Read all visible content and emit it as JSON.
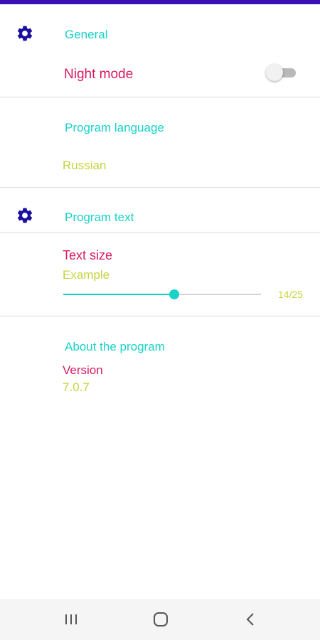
{
  "colors": {
    "status_bar": "#3b0fb5",
    "icon": "#1a0f9e",
    "heading": "#19d2c8",
    "primary_text": "#d81b60",
    "secondary_text": "#c6d43c",
    "slider_accent": "#19d2c8",
    "nav_icon": "#555555"
  },
  "sections": {
    "general": {
      "icon": "gear-icon",
      "title": "General",
      "night_mode_label": "Night mode",
      "night_mode_on": false
    },
    "language": {
      "title": "Program language",
      "value": "Russian"
    },
    "program_text": {
      "icon": "gear-icon",
      "title": "Program text",
      "text_size_label": "Text size",
      "example_label": "Example",
      "slider_value": 14,
      "slider_max": 25,
      "slider_readout": "14/25"
    },
    "about": {
      "title": "About the program",
      "version_label": "Version",
      "version_value": "7.0.7"
    }
  },
  "nav_bar": {
    "recents_icon": "recents-icon",
    "home_icon": "home-icon",
    "back_icon": "back-icon"
  }
}
